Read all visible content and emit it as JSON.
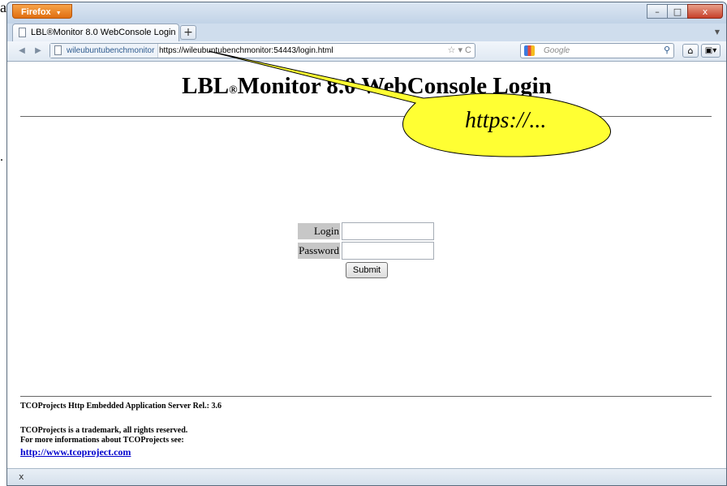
{
  "stray_marks": {
    "char": "a",
    "dot": "."
  },
  "browser": {
    "app_button": "Firefox",
    "app_button_arrow": "▼",
    "window_controls": [
      "–",
      "□",
      "x"
    ],
    "tab_title": "LBL®Monitor 8.0 WebConsole Login",
    "new_tab": "+",
    "tab_list_chevron": "▼",
    "nav_back": "◀",
    "nav_forward": "▶",
    "site_identity": "wileubuntubenchmonitor",
    "url": "https://wileubuntubenchmonitor:54443/login.html",
    "url_controls": "☆ ▾ C",
    "search_placeholder": "Google",
    "search_icon": "⚲",
    "home_icon": "⌂",
    "menu_icon": "▣▾",
    "status_close": "x"
  },
  "page": {
    "title_main": "LBL",
    "title_reg": "®",
    "title_rest": "Monitor 8.0 WebConsole Login",
    "login_label": "Login",
    "login_value": "",
    "password_label": "Password",
    "password_value": "",
    "submit_label": "Submit"
  },
  "footer": {
    "server_line": "TCOProjects  Http Embedded Application Server Rel.: 3.6",
    "trademark_line": "TCOProjects is a trademark, all rights reserved.",
    "info_line": "For more informations about TCOProjects see:",
    "link_text": "http://www.tcoproject.com"
  },
  "callout": {
    "text": "https://...",
    "fill_color": "#ffff33"
  }
}
